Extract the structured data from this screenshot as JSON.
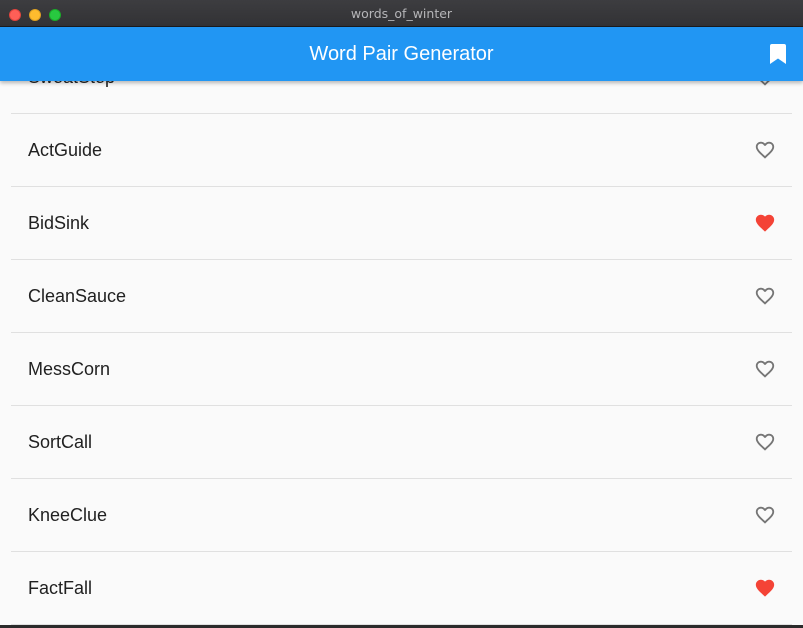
{
  "window": {
    "title": "words_of_winter"
  },
  "appbar": {
    "title": "Word Pair Generator",
    "action_icon": "bookmark-icon"
  },
  "colors": {
    "primary": "#2196f3",
    "favorite": "#f44336",
    "unfavorite": "#757575"
  },
  "list": {
    "items": [
      {
        "label": "SweatStep",
        "favorite": false
      },
      {
        "label": "ActGuide",
        "favorite": false
      },
      {
        "label": "BidSink",
        "favorite": true
      },
      {
        "label": "CleanSauce",
        "favorite": false
      },
      {
        "label": "MessCorn",
        "favorite": false
      },
      {
        "label": "SortCall",
        "favorite": false
      },
      {
        "label": "KneeClue",
        "favorite": false
      },
      {
        "label": "FactFall",
        "favorite": true
      }
    ]
  }
}
